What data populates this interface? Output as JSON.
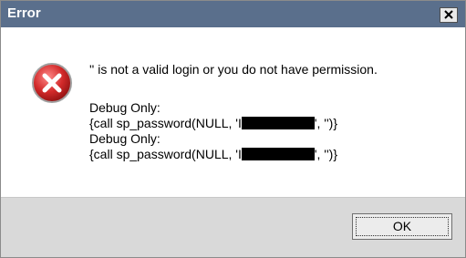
{
  "window": {
    "title": "Error",
    "close_glyph": "✕"
  },
  "message": {
    "icon": "error-icon",
    "text": "'' is not a valid login or you do not have permission."
  },
  "debug": [
    {
      "label": "Debug Only:",
      "call_prefix": "{call sp_password(NULL, 'I",
      "call_suffix": "', '')}"
    },
    {
      "label": "Debug Only:",
      "call_prefix": "{call sp_password(NULL, 'I",
      "call_suffix": "', '')}"
    }
  ],
  "buttons": {
    "ok_label": "OK"
  },
  "colors": {
    "titlebar": "#5a6f8c",
    "footer": "#d9d9d9",
    "icon_red": "#d22a2a"
  }
}
